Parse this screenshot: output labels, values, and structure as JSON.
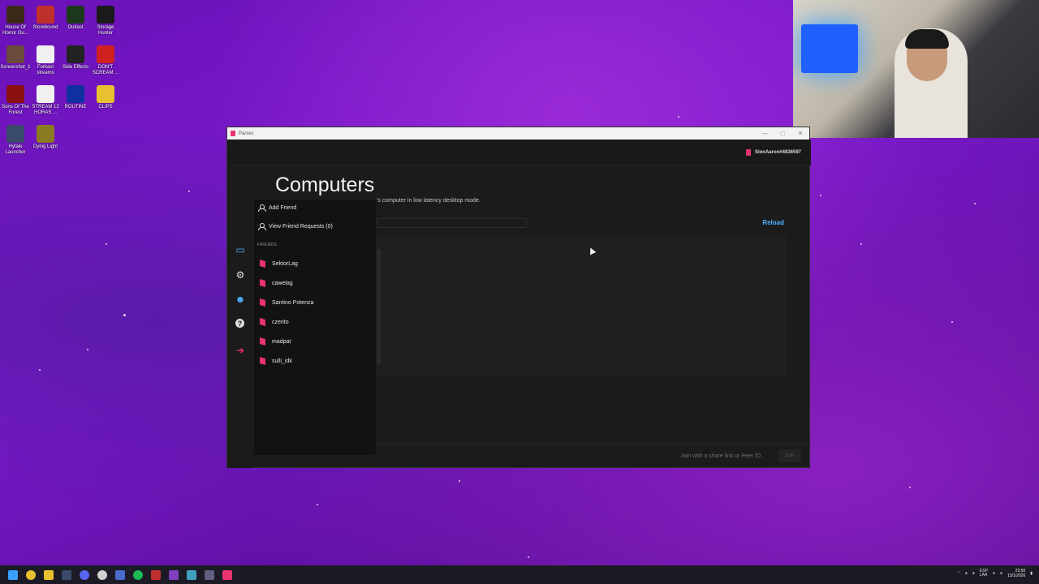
{
  "desktop": {
    "icons": [
      {
        "label": "House Of Horror Ou...",
        "color": "#3b2a1a"
      },
      {
        "label": "Storebound",
        "color": "#c0302a"
      },
      {
        "label": "Outlast",
        "color": "#1b3a1b"
      },
      {
        "label": "Storage Hunter",
        "color": "#1a1a1a"
      },
      {
        "label": "Screenshot_1",
        "color": "#6a4a3a"
      },
      {
        "label": "Forkast streams",
        "color": "#f0f0f0"
      },
      {
        "label": "Side Effects",
        "color": "#222222"
      },
      {
        "label": "DON'T SCREAM ...",
        "color": "#d02020"
      },
      {
        "label": "Sons Of The Forest",
        "color": "#8a1010"
      },
      {
        "label": "STREAM 12 HORAS ...",
        "color": "#f0f0f0"
      },
      {
        "label": "ROUTINE",
        "color": "#1030a0"
      },
      {
        "label": "CLIPS",
        "color": "#e8c030"
      },
      {
        "label": "Hytale Launcher",
        "color": "#3a4a6a"
      },
      {
        "label": "Dying Light",
        "color": "#8a7a20"
      }
    ]
  },
  "window": {
    "title": "Parsec",
    "controls": {
      "minimize": "—",
      "maximize": "□",
      "close": "✕"
    },
    "user": "SionAaron#4836597",
    "page_title": "Computers",
    "subtitle": "'s computer in low latency desktop mode.",
    "reload": "Reload",
    "join_hint": "Join with a share link or Peer ID.",
    "join_button": "Join"
  },
  "friends_panel": {
    "add_friend": "Add Friend",
    "view_requests": "View Friend Requests (0)",
    "section": "FRIENDS",
    "friends": [
      "SektorLag",
      "cawelag",
      "Santino Potenza",
      "czerito",
      "madpat",
      "sulli_idk"
    ]
  },
  "nav": {
    "computers_icon": "monitor-icon",
    "settings_icon": "gear-icon",
    "friends_icon": "friends-icon",
    "help_icon": "help-icon",
    "logout_icon": "logout-icon"
  },
  "taskbar": {
    "language": "ESP\nLAA",
    "time": "23:50",
    "date": "13/1/2026"
  },
  "colors": {
    "accent_pink": "#e8336e",
    "accent_blue": "#4fb3ff"
  }
}
